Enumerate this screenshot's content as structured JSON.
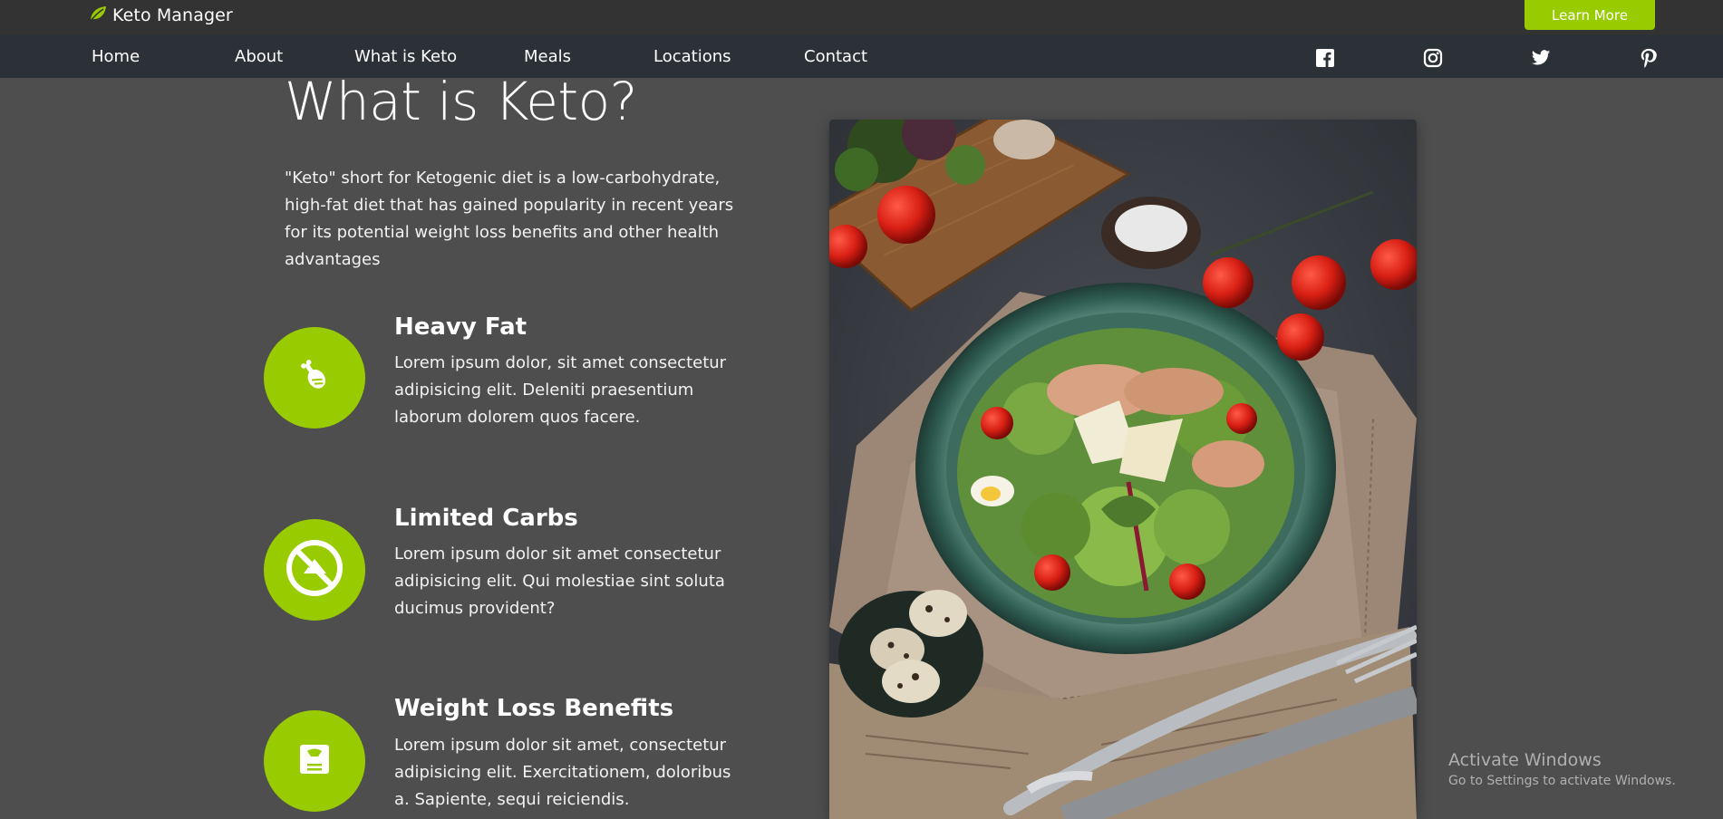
{
  "header": {
    "brand": "Keto Manager",
    "brand_icon": "leaf-icon",
    "cta_label": "Learn More",
    "accent_color": "#99cc00"
  },
  "nav": {
    "items": [
      "Home",
      "About",
      "What is Keto",
      "Meals",
      "Locations",
      "Contact"
    ],
    "social_icons": [
      "facebook-icon",
      "instagram-icon",
      "twitter-icon",
      "pinterest-icon"
    ]
  },
  "main": {
    "title": "What is Keto?",
    "intro": "\"Keto\" short for Ketogenic diet is a low-carbohydrate, high-fat diet that has gained popularity in recent years for its potential weight loss benefits and other health advantages",
    "features": [
      {
        "title": "Heavy Fat",
        "text": "Lorem ipsum dolor, sit amet consectetur adipisicing elit. Deleniti praesentium laborum dolorem quos facere.",
        "icon": "drumstick-icon"
      },
      {
        "title": "Limited Carbs",
        "text": "Lorem ipsum dolor sit amet consectetur adipisicing elit. Qui molestiae sint soluta ducimus provident?",
        "icon": "no-bread-icon"
      },
      {
        "title": "Weight Loss Benefits",
        "text": "Lorem ipsum dolor sit amet, consectetur adipisicing elit. Exercitationem, doloribus a. Sapiente, sequi reiciendis.",
        "icon": "scale-icon"
      }
    ],
    "image": "salad-bowl-photo"
  },
  "watermark": {
    "title": "Activate Windows",
    "subtitle": "Go to Settings to activate Windows."
  }
}
